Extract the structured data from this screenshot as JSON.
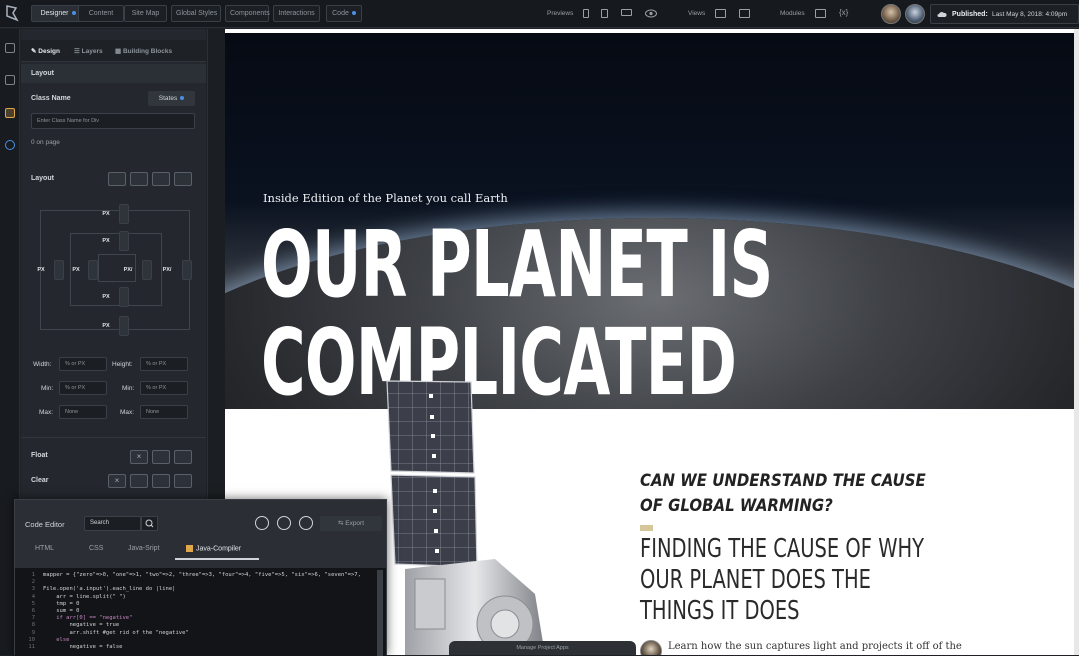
{
  "topbar": {
    "tabs": [
      {
        "label": "Designer",
        "active": true,
        "dot": true
      },
      {
        "label": "Content",
        "active": false,
        "dot": false
      },
      {
        "label": "Site Map",
        "active": false,
        "dot": false
      },
      {
        "label": "Global Styles",
        "active": false,
        "dot": false
      },
      {
        "label": "Components",
        "active": false,
        "dot": false
      },
      {
        "label": "Interactions",
        "active": false,
        "dot": false
      },
      {
        "label": "Code",
        "active": false,
        "dot": true
      }
    ],
    "previews_label": "Previews",
    "views_label": "Views",
    "modules_label": "Modules",
    "published_label": "Published:",
    "published_value": "Last May 8, 2018: 4:09pm",
    "accent": "#4a90e2"
  },
  "panel": {
    "tabs": [
      "Design",
      "Layers",
      "Building Blocks"
    ],
    "section_layout": "Layout",
    "class_name_label": "Class Name",
    "states_label": "States",
    "class_placeholder": "Enter Class Name for Div",
    "on_page": "0 on page",
    "layout_label": "Layout",
    "box_values": {
      "margin_top": "PX",
      "padding_top": "PX",
      "margin_left": "PX",
      "padding_left": "PX",
      "padding_right": "PX/",
      "margin_right": "PX/",
      "padding_bottom": "PX",
      "margin_bottom": "PX"
    },
    "width_label": "Width:",
    "width_value": "% or PX",
    "height_label": "Height:",
    "height_value": "% or PX",
    "min_label": "Min:",
    "min_w": "% or PX",
    "min_label2": "Min:",
    "min_h": "% or PX",
    "max_label": "Max:",
    "max_w": "None",
    "max_label2": "Max:",
    "max_h": "None",
    "float_label": "Float",
    "clear_label": "Clear"
  },
  "editor": {
    "title": "Code Editor",
    "search_value": "Search",
    "export_label": "Export",
    "tabs": [
      "HTML",
      "CSS",
      "Java-Sript",
      "Java-Compiler"
    ],
    "active_tab": "Java-Compiler",
    "lines": [
      "mapper = {\"zero\"=>0, \"one\"=>1, \"two\"=>2, \"three\"=>3, \"four\"=>4, \"five\"=>5, \"six\"=>6, \"seven\"=>7,",
      "",
      "File.open('a.input').each_line do |line|",
      "    arr = line.split(\" \")",
      "    tmp = 0",
      "    sum = 0",
      "    if arr[0] == \"negative\"",
      "        negative = true",
      "        arr.shift #get rid of the \"negative\"",
      "    else",
      "        negative = false"
    ]
  },
  "canvas": {
    "subtitle": "Inside Edition of the Planet you call Earth",
    "title_line1": "OUR PLANET IS",
    "title_line2": "COMPLICATED",
    "question": "CAN WE UNDERSTAND THE CAUSE OF GLOBAL WARMING?",
    "heading": "FINDING THE CAUSE OF WHY OUR PLANET DOES THE THINGS IT DOES",
    "body": "Learn how the sun captures light and projects it off of the"
  },
  "manage_label": "Manage Project Apps"
}
